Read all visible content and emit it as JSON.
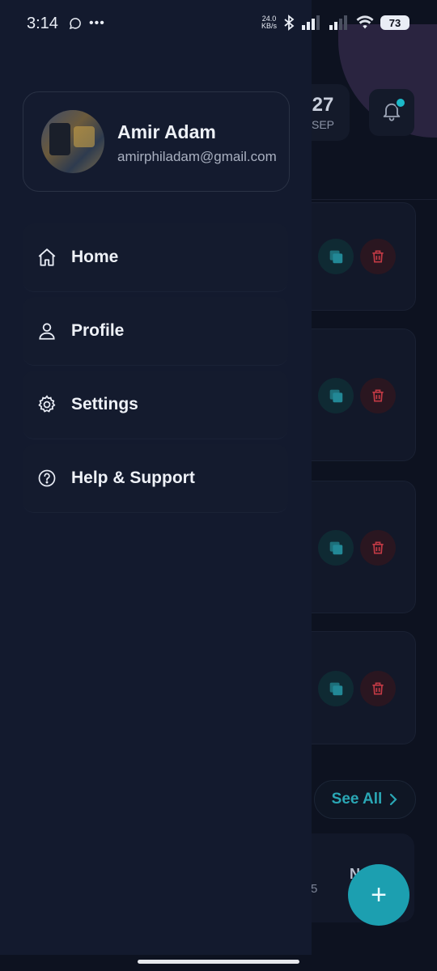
{
  "status_bar": {
    "time": "3:14",
    "net_speed_top": "24.0",
    "net_speed_bottom": "KB/s",
    "battery": "73"
  },
  "background": {
    "date_day": "27",
    "date_month": "SEP",
    "see_all_label": "See All",
    "bottom_number": "5",
    "bottom_letter": "N",
    "fab_label": "+"
  },
  "drawer": {
    "user_name": "Amir Adam",
    "user_email": "amirphiladam@gmail.com",
    "menu": [
      {
        "label": "Home",
        "icon": "home-icon"
      },
      {
        "label": "Profile",
        "icon": "user-icon"
      },
      {
        "label": "Settings",
        "icon": "gear-icon"
      },
      {
        "label": "Help & Support",
        "icon": "help-icon"
      }
    ]
  },
  "colors": {
    "drawer_bg": "#131a2e",
    "accent": "#1c9fb0",
    "danger": "#c33a45"
  }
}
